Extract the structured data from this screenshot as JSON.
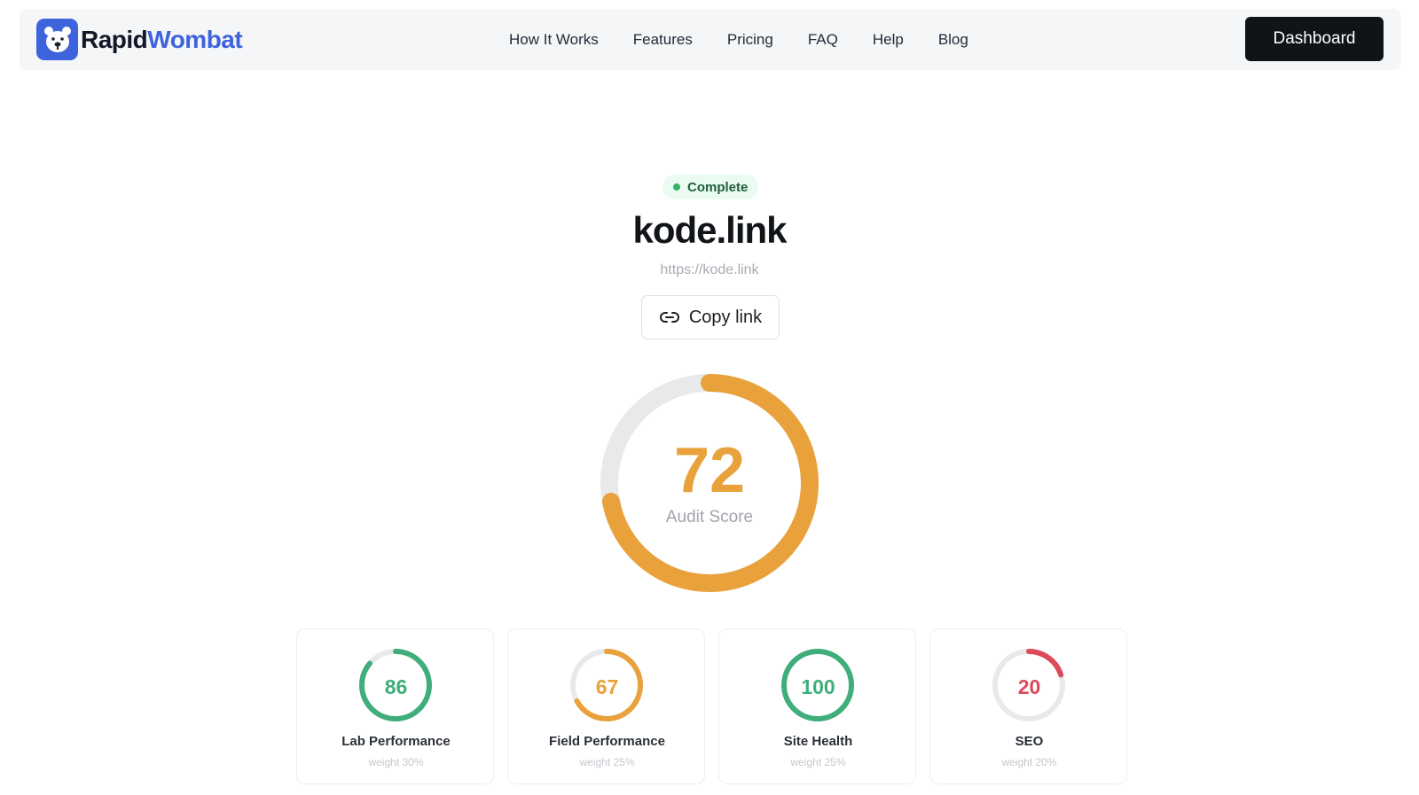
{
  "brand": {
    "name_part1": "Rapid",
    "name_part2": "Wombat",
    "logo_icon": "wombat-face-icon",
    "accent": "#3d63dd"
  },
  "nav": {
    "links": [
      "How It Works",
      "Features",
      "Pricing",
      "FAQ",
      "Help",
      "Blog"
    ],
    "cta_label": "Dashboard"
  },
  "report": {
    "status": "Complete",
    "status_color": "#34b36b",
    "site": "kode.link",
    "url": "https://kode.link",
    "copy_label": "Copy link",
    "copy_icon": "link-icon",
    "audit_score": 72,
    "audit_label": "Audit Score",
    "audit_color": "#e9a23b"
  },
  "categories": [
    {
      "score": 86,
      "name": "Lab Performance",
      "weight": "weight 30%",
      "color": "#3fae7a"
    },
    {
      "score": 67,
      "name": "Field Performance",
      "weight": "weight 25%",
      "color": "#e9a23b"
    },
    {
      "score": 100,
      "name": "Site Health",
      "weight": "weight 25%",
      "color": "#3fae7a"
    },
    {
      "score": 20,
      "name": "SEO",
      "weight": "weight 20%",
      "color": "#dc4a5b"
    }
  ]
}
